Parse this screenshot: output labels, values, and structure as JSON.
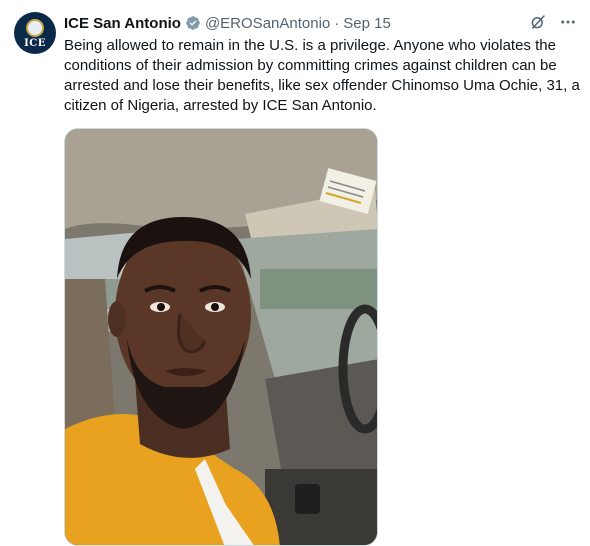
{
  "account": {
    "display_name": "ICE San Antonio",
    "handle": "@EROSanAntonio",
    "separator": "·",
    "date": "Sep 15",
    "avatar_text": "ICE"
  },
  "tweet": {
    "text": "Being allowed to remain in the U.S. is a privilege. Anyone who violates the conditions of their admission by committing crimes against children can be arrested and lose their benefits, like sex offender Chinomso Uma Ochie, 31, a citizen of Nigeria, arrested by ICE San Antonio."
  },
  "icons": {
    "verified": "verified-badge-icon",
    "grok": "grok-icon",
    "more": "more-icon"
  },
  "colors": {
    "text": "#0f1419",
    "secondary": "#536471",
    "badge": "#829aab"
  }
}
